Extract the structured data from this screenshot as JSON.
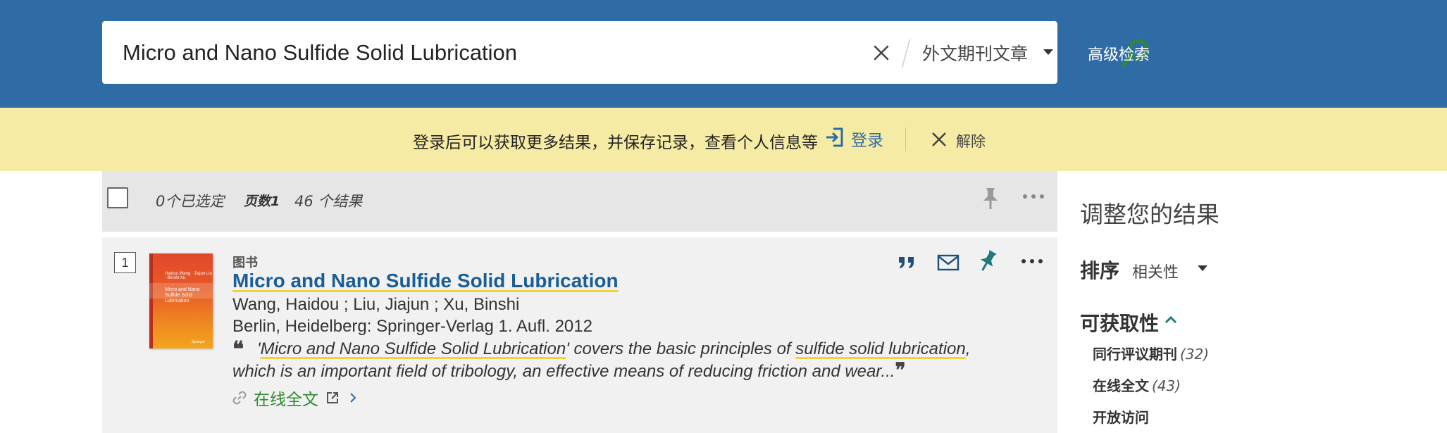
{
  "search": {
    "query": "Micro and Nano Sulfide Solid Lubrication",
    "scope": "外文期刊文章",
    "advanced_label": "高级检索"
  },
  "banner": {
    "message": "登录后可以获取更多结果，并保存记录，查看个人信息等",
    "login_label": "登录",
    "dismiss_label": "解除"
  },
  "toolbar": {
    "selected_count": "0个已选定",
    "page_label": "页数1",
    "result_count": "46 个结果"
  },
  "result": {
    "rank": "1",
    "type": "图书",
    "title": "Micro and Nano Sulfide Solid Lubrication",
    "authors": "Wang, Haidou ; Liu, Jiajun ; Xu, Binshi",
    "publication": "Berlin, Heidelberg: Springer-Verlag 1. Aufl. 2012",
    "quote_open": "❝",
    "snippet_q1": "'",
    "snippet_hl1": "Micro and Nano Sulfide Solid Lubrication",
    "snippet_mid": "' covers the basic principles of ",
    "snippet_hl2": "sulfide solid lubrication",
    "snippet_end": ", which is an important field of tribology, an effective means of reducing friction and wear...",
    "quote_close": "❞",
    "fulltext_label": "在线全文",
    "cover": {
      "authors": "Haidou Wang · Jiajun Liu · Binshi Xu",
      "title": "Micro and Nano Sulfide Solid Lubrication",
      "publisher": "Springer"
    }
  },
  "sidebar": {
    "title": "调整您的结果",
    "sort_label": "排序",
    "sort_value": "相关性",
    "availability_label": "可获取性",
    "facets": [
      {
        "name": "同行评议期刊",
        "count": "(32)"
      },
      {
        "name": "在线全文",
        "count": "(43)"
      },
      {
        "name": "开放访问",
        "count": ""
      }
    ]
  },
  "icons": {
    "clear": "close-icon",
    "mic": "microphone-icon",
    "search": "search-icon",
    "login": "sign-in-icon",
    "pin": "pin-icon",
    "more": "more-horizontal-icon",
    "cite": "quote-icon",
    "email": "email-icon",
    "link": "link-icon",
    "external": "external-link-icon"
  },
  "colors": {
    "header_bg": "#2f6ca6",
    "banner_bg": "#f6eba4",
    "title_link": "#1b5e96",
    "highlight": "#f2d23c",
    "fulltext_green": "#2f8a2f",
    "search_green": "#2e8b2e",
    "pin_teal": "#1f7b7b"
  }
}
